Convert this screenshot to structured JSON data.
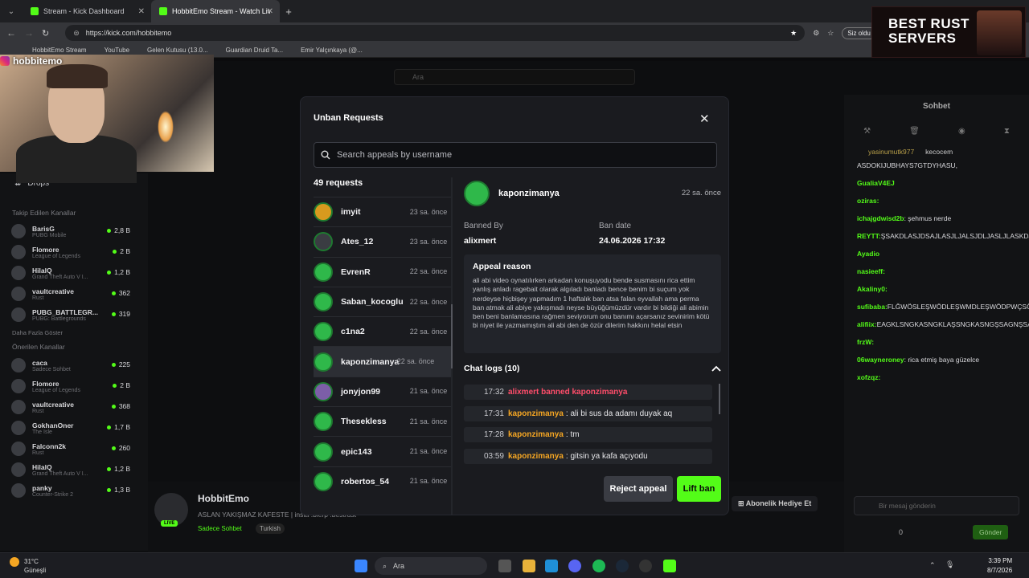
{
  "browser": {
    "tabs": [
      {
        "label": "Stream - Kick Dashboard"
      },
      {
        "label": "HobbitEmo Stream - Watch Live o"
      }
    ],
    "url": "https://kick.com/hobbitemo",
    "profile_button": "Siz oldu",
    "bookmarks": [
      "HobbitEmo Stream",
      "YouTube",
      "Gelen Kutusu (13.0...",
      "Guardian Druid Ta...",
      "Emir Yalçınkaya (@..."
    ]
  },
  "overlay": {
    "instagram_handle": "hobbitemo",
    "ad_text": "BEST RUST SERVERS"
  },
  "site": {
    "search_placeholder": "Ara",
    "drops_label": "Drops",
    "followed_title": "Takip Edilen Kanallar",
    "followed": [
      {
        "name": "BarisG",
        "game": "PUBG Mobile",
        "viewers": "2,8 B"
      },
      {
        "name": "Flomore",
        "game": "League of Legends",
        "viewers": "2 B"
      },
      {
        "name": "HilalQ",
        "game": "Grand Theft Auto V I...",
        "viewers": "1,2 B"
      },
      {
        "name": "vaultcreative",
        "game": "Rust",
        "viewers": "362"
      },
      {
        "name": "PUBG_BATTLEGR...",
        "game": "PUBG: Battlegrounds",
        "viewers": "319"
      }
    ],
    "show_more": "Daha Fazla Göster",
    "recommended_title": "Önerilen Kanallar",
    "recommended": [
      {
        "name": "caca",
        "game": "Sadece Sohbet",
        "viewers": "225"
      },
      {
        "name": "Flomore",
        "game": "League of Legends",
        "viewers": "2 B"
      },
      {
        "name": "vaultcreative",
        "game": "Rust",
        "viewers": "368"
      },
      {
        "name": "GokhanOner",
        "game": "The Isle",
        "viewers": "1,7 B"
      },
      {
        "name": "Falconn2k",
        "game": "Rust",
        "viewers": "260"
      },
      {
        "name": "HilalQ",
        "game": "Grand Theft Auto V I...",
        "viewers": "1,2 B"
      },
      {
        "name": "panky",
        "game": "Counter-Strike 2",
        "viewers": "1,3 B"
      }
    ],
    "streamer": "HobbitEmo",
    "stream_title": "ASLAN YAKIŞMAZ KAFESTE | insta :bierp !bestrust",
    "tags": [
      "Sadece Sohbet",
      "Turkish"
    ],
    "live_badge": "LIVE",
    "subscribe_gift": "Abonelik Hediye Et"
  },
  "chat": {
    "title": "Sohbet",
    "pinned_users": [
      "yasinumutk977",
      "kecocem"
    ],
    "messages": [
      {
        "user": "",
        "text": "ASDOKIJUBHAYS7GTDYHASU,"
      },
      {
        "user": "GualiaV4EJ",
        "text": ""
      },
      {
        "user": "oziras:",
        "text": ""
      },
      {
        "user": "ichajgdwisd2b",
        "text": ": şehmus nerde"
      },
      {
        "user": "REYTT:",
        "text": "ŞSAKDLASJDSAJLASJLJALSJDLJASLJLASKDJALSKJD"
      },
      {
        "user": "Ayadio",
        "text": ""
      },
      {
        "user": "nasieeff:",
        "text": ""
      },
      {
        "user": "Akaliny0:",
        "text": ""
      },
      {
        "user": "sufibaba:",
        "text": "FLĞWÖSLEŞWÖDLEŞWMDLEŞWÖDPWÇSÖDŞWİDÖEŞWİÖDŞWİSÖFĞWİDÖRLWĞ"
      },
      {
        "user": "alifiix:",
        "text": "EAGKLSNGKASNGKLAŞSNGKASNGŞSAGNŞSAKGJGOPJSAGJASGŞSA"
      },
      {
        "user": "frzW:",
        "text": ""
      },
      {
        "user": "06wayneroney",
        "text": ": rica etmiş baya güzelce"
      },
      {
        "user": "xofzqz:",
        "text": ""
      }
    ],
    "input_placeholder": "Bir mesaj gönderin",
    "points": "0",
    "send_label": "Gönder"
  },
  "modal": {
    "title": "Unban Requests",
    "search_placeholder": "Search appeals by username",
    "count_label": "49 requests",
    "requests": [
      {
        "user": "imyit",
        "time": "23 sa. önce",
        "color": "#d79a1e"
      },
      {
        "user": "Ates_12",
        "time": "23 sa. önce",
        "color": "#3a3c42"
      },
      {
        "user": "EvrenR",
        "time": "22 sa. önce",
        "color": "#2fb84a"
      },
      {
        "user": "Saban_kocoglu",
        "time": "22 sa. önce",
        "color": "#2fb84a"
      },
      {
        "user": "c1na2",
        "time": "22 sa. önce",
        "color": "#2fb84a"
      },
      {
        "user": "kaponzimanya",
        "time": "22 sa. önce",
        "color": "#2fb84a",
        "selected": true
      },
      {
        "user": "jonyjon99",
        "time": "21 sa. önce",
        "color": "#7c5ea8"
      },
      {
        "user": "Thesekless",
        "time": "21 sa. önce",
        "color": "#2fb84a"
      },
      {
        "user": "epic143",
        "time": "21 sa. önce",
        "color": "#2fb84a"
      },
      {
        "user": "robertos_54",
        "time": "21 sa. önce",
        "color": "#2fb84a"
      }
    ],
    "detail": {
      "user": "kaponzimanya",
      "time": "22 sa. önce",
      "banned_by_label": "Banned By",
      "banned_by": "alixmert",
      "ban_date_label": "Ban date",
      "ban_date": "24.06.2026 17:32",
      "appeal_reason_label": "Appeal reason",
      "appeal_reason": "ali abi video oynatılırken arkadan konuşuyodu bende susmasını rica ettim yanlış anladı ragebait olarak algıladı banladı bence benim bi suçum yok nerdeyse hiçbişey yapmadım 1 haftalık ban atsa falan eyvallah ama perma ban atmak ali abiye yakışmadı neyse büyüğümüzdür vardır bi bildiği ali abimin ben beni banlamasına rağmen seviyorum onu banımı açarsanız sevinirim kötü bi niyet ile yazmamıştım ali abi den de özür dilerim hakkını helal etsin",
      "chat_logs_label": "Chat logs (10)",
      "logs": [
        {
          "time": "17:32",
          "user": "alixmert banned kaponzimanya",
          "msg": "",
          "type": "ban"
        },
        {
          "time": "17:31",
          "user": "kaponzimanya",
          "msg": ": ali bi sus da adamı duyak aq",
          "type": "msg"
        },
        {
          "time": "17:28",
          "user": "kaponzimanya",
          "msg": ": tm",
          "type": "msg"
        },
        {
          "time": "03:59",
          "user": "kaponzimanya",
          "msg": ": gitsin ya kafa açıyodu",
          "type": "msg"
        }
      ]
    },
    "reject_label": "Reject appeal",
    "lift_label": "Lift ban",
    "accent": "#53fc18"
  },
  "taskbar": {
    "temp": "31°C",
    "weather": "Güneşli",
    "search": "Ara",
    "time": "3:39 PM",
    "date": "8/7/2026"
  }
}
